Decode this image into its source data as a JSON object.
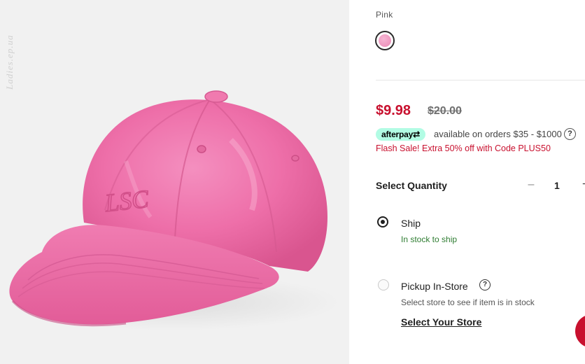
{
  "watermark": "Ladies.ep.ua",
  "product": {
    "color_label": "Pink",
    "swatch_color": "#ee8fbb",
    "swatch_icon": "color-swatch-icon"
  },
  "logo_text": "LSC",
  "price": {
    "current": "$9.98",
    "original": "$20.00",
    "current_color": "#c8102e"
  },
  "afterpay": {
    "badge": "afterpay⇄",
    "text": "available on orders $35 - $1000",
    "help_icon": "?"
  },
  "promo": {
    "text": "Flash Sale! Extra 50% off with Code PLUS50"
  },
  "quantity": {
    "label": "Select Quantity",
    "minus": "–",
    "value": "1",
    "plus": "+"
  },
  "fulfillment": {
    "ship": {
      "label": "Ship",
      "status": "In stock to ship",
      "selected": true
    },
    "pickup": {
      "label": "Pickup In-Store",
      "help_icon": "?",
      "subtext": "Select store to see if item is in stock",
      "link": "Select Your Store",
      "selected": false
    }
  },
  "colors": {
    "accent": "#c8102e",
    "stock_green": "#2f7d32",
    "afterpay_mint": "#b2fce4",
    "cap_pink": "#ef6ea8"
  }
}
